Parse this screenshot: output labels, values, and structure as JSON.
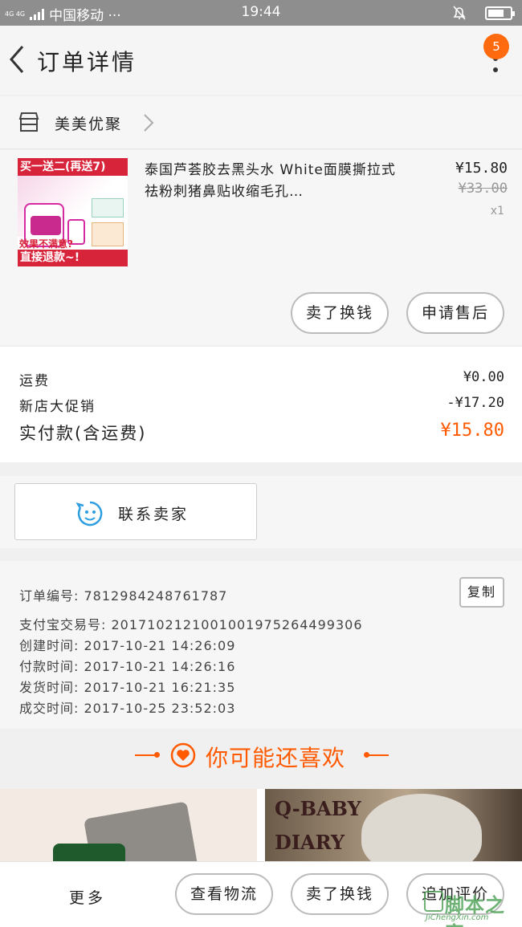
{
  "status_bar": {
    "network": "4G 4G",
    "carrier": "中国移动 ···",
    "time": "19:44"
  },
  "nav": {
    "title": "订单详情",
    "badge": "5"
  },
  "shop": {
    "name": "美美优聚"
  },
  "item": {
    "title": "泰国芦荟胶去黑头水 White面膜撕拉式祛粉刺猪鼻贴收缩毛孔…",
    "price": "¥15.80",
    "original_price": "¥33.00",
    "quantity": "x1",
    "thumb_banner_top": "买一送二(再送7)",
    "thumb_text_mid": "效果不满意?",
    "thumb_banner_bottom": "直接退款~!"
  },
  "item_actions": {
    "refund_exchange": "卖了换钱",
    "after_sale": "申请售后"
  },
  "fees": {
    "shipping_label": "运费",
    "shipping_value": "¥0.00",
    "promo_label": "新店大促销",
    "promo_value": "-¥17.20",
    "total_label": "实付款(含运费)",
    "total_value": "¥15.80"
  },
  "contact": {
    "label": "联系卖家"
  },
  "order_info": {
    "order_no": "订单编号: 7812984248761787",
    "copy_label": "复制",
    "alipay_no": "支付宝交易号: 2017102121001001975264499306",
    "created": "创建时间: 2017-10-21 14:26:09",
    "paid": "付款时间: 2017-10-21 14:26:16",
    "shipped": "发货时间: 2017-10-21 16:21:35",
    "completed": "成交时间: 2017-10-25 23:52:03"
  },
  "recommend": {
    "title": "你可能还喜欢",
    "card2_line1": "Q-BABY",
    "card2_line2": "DIARY"
  },
  "bottom_bar": {
    "more": "更多",
    "logistics": "查看物流",
    "sell": "卖了换钱",
    "review": "追加评价"
  },
  "watermark": {
    "text": "脚本之家",
    "url": "JiChengXin.com"
  },
  "colors": {
    "accent": "#ff5a00",
    "badge": "#ff6a0e",
    "price_red": "#d8243a"
  }
}
